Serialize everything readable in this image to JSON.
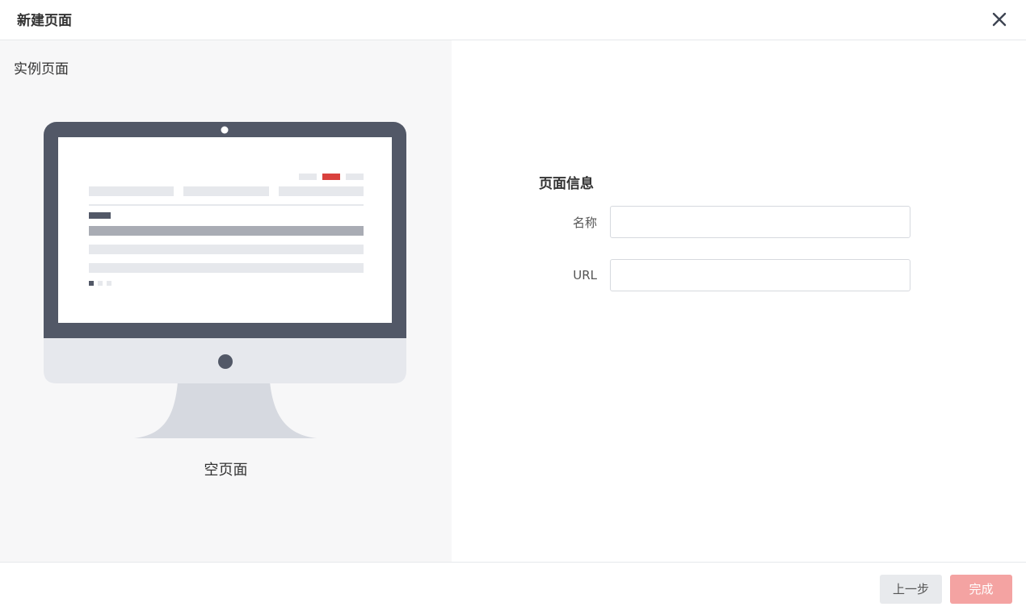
{
  "dialog": {
    "title": "新建页面"
  },
  "left": {
    "title": "实例页面",
    "template_label": "空页面"
  },
  "form": {
    "section_title": "页面信息",
    "name_label": "名称",
    "name_value": "",
    "url_label": "URL",
    "url_value": ""
  },
  "footer": {
    "prev_label": "上一步",
    "finish_label": "完成"
  },
  "colors": {
    "accent": "#f4a3a2",
    "monitor_frame": "#525867",
    "highlight_bar": "#d9413d"
  },
  "icons": {
    "close": "close-icon",
    "monitor": "monitor-illustration"
  }
}
